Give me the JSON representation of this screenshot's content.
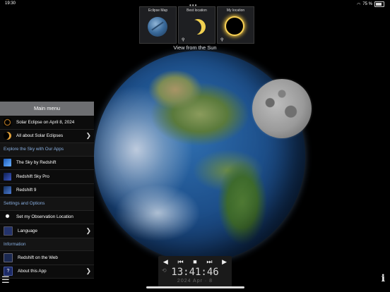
{
  "status": {
    "time": "19:30",
    "battery": "75 %"
  },
  "multitask_dots": "•••",
  "thumbnails": [
    {
      "label": "Eclipse Map",
      "icon": "globe-icon"
    },
    {
      "label": "Best location",
      "icon": "crescent-sun-icon"
    },
    {
      "label": "My location",
      "icon": "eclipse-ring-icon"
    }
  ],
  "view_label": "View from the Sun",
  "menu": {
    "title": "Main menu",
    "items": [
      {
        "label": "Solar Eclipse on April 8, 2024"
      },
      {
        "label": "All about Solar Eclipses"
      }
    ],
    "section1": "Explore the Sky with Our Apps",
    "apps": [
      {
        "label": "The Sky by Redshift"
      },
      {
        "label": "Redshift Sky Pro"
      },
      {
        "label": "Redshift 9"
      }
    ],
    "section2": "Settings and Options",
    "settings": [
      {
        "label": "Set my Observation Location"
      },
      {
        "label": "Language"
      }
    ],
    "section3": "Information",
    "info": [
      {
        "label": "Redshift on the Web"
      },
      {
        "label": "About this App"
      }
    ]
  },
  "controls": {
    "prev": "◀",
    "step_back": "⏮",
    "stop": "■",
    "step_forward": "⏭",
    "next": "▶",
    "clock": "13:41:46",
    "date": "2024 Apr · 8"
  },
  "hamburger": "☰",
  "info_button": "i"
}
